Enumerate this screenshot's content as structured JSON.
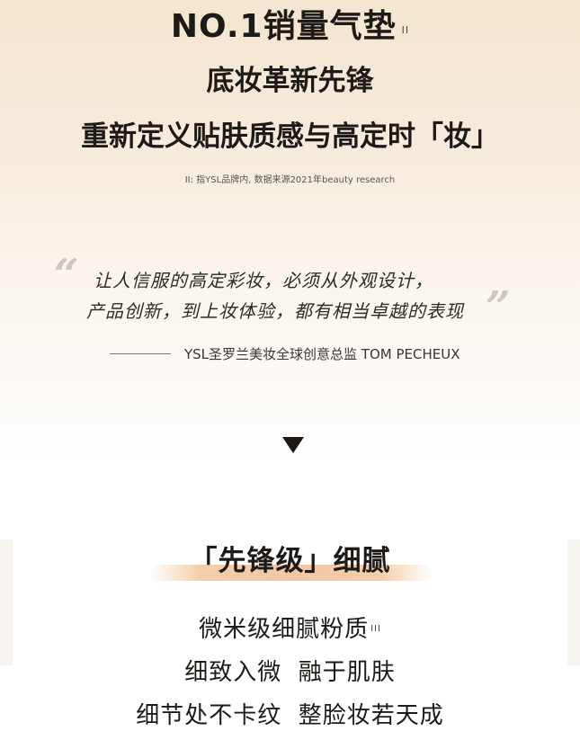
{
  "hero": {
    "headline": "NO.1销量气垫",
    "headline_sup": "II",
    "subtitle1": "底妆革新先锋",
    "subtitle2": "重新定义贴肤质感与高定时「妆」",
    "footnote": "II: 指YSL品牌内, 数据来源2021年beauty research"
  },
  "quote": {
    "line1": "让人信服的高定彩妆，必须从外观设计，",
    "line2": "产品创新，到上妆体验，都有相当卓越的表现",
    "attribution": "YSL圣罗兰美妆全球创意总监 TOM PECHEUX"
  },
  "section": {
    "title": "「先锋级」细腻",
    "feature1": "微米级细腻粉质",
    "feature1_sup": "III",
    "feature2": "细致入微  融于肌肤",
    "feature3": "细节处不卡纹  整脸妆若天成"
  },
  "icons": {
    "down": "down-triangle-icon",
    "quote_open": "quote-open-icon",
    "quote_close": "quote-close-icon"
  }
}
